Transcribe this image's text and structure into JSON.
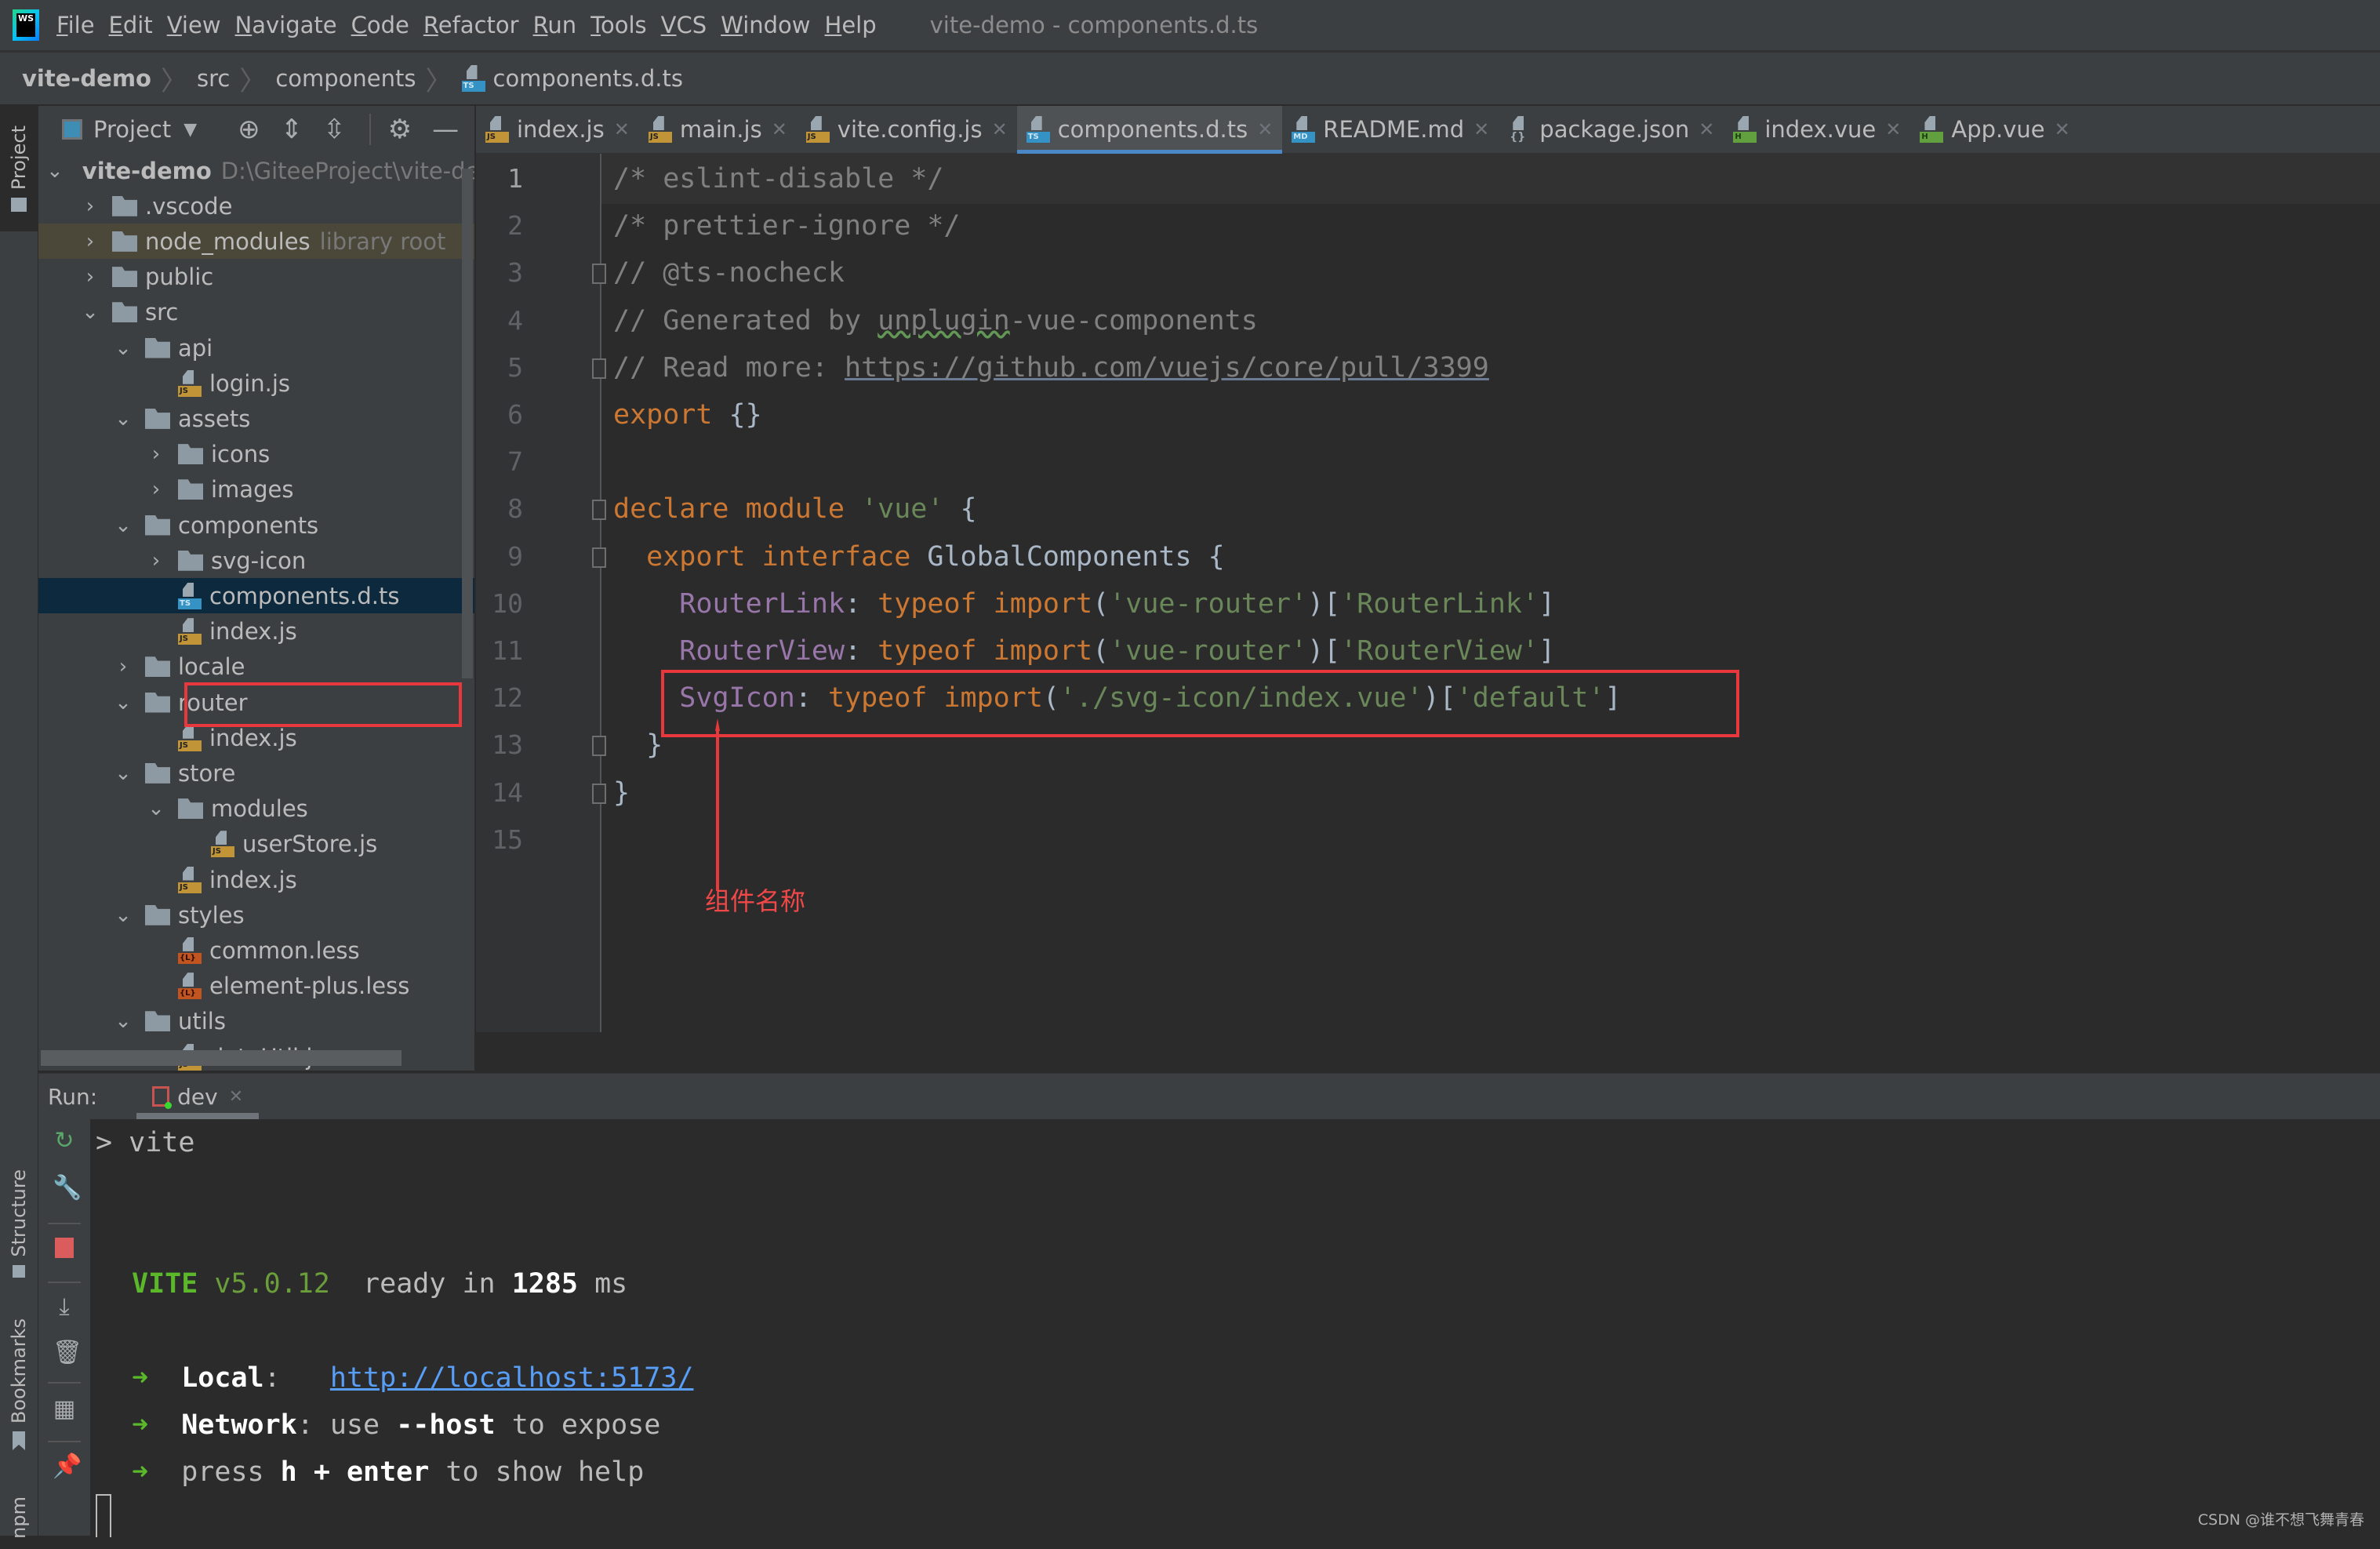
{
  "app": {
    "logo_text": "WS",
    "window_title": "vite-demo - components.d.ts"
  },
  "menu": [
    "File",
    "Edit",
    "View",
    "Navigate",
    "Code",
    "Refactor",
    "Run",
    "Tools",
    "VCS",
    "Window",
    "Help"
  ],
  "breadcrumb": [
    "vite-demo",
    "src",
    "components",
    "components.d.ts"
  ],
  "left_stripe": {
    "project": "Project",
    "structure": "Structure",
    "bookmarks": "Bookmarks",
    "npm": "npm"
  },
  "project_panel": {
    "view_label": "Project",
    "toolbar_icons": [
      "locate-icon",
      "expand-all-icon",
      "collapse-all-icon",
      "gear-icon",
      "hide-icon"
    ],
    "tree": [
      {
        "label": "vite-demo",
        "hint": "D:\\GiteeProject\\vite-demo",
        "type": "folder",
        "depth": 0,
        "expanded": true,
        "bold": true
      },
      {
        "label": ".vscode",
        "type": "folder",
        "depth": 1,
        "expanded": false
      },
      {
        "label": "node_modules",
        "hint": "library root",
        "type": "folder",
        "depth": 1,
        "expanded": false
      },
      {
        "label": "public",
        "type": "folder",
        "depth": 1,
        "expanded": false
      },
      {
        "label": "src",
        "type": "folder",
        "depth": 1,
        "expanded": true
      },
      {
        "label": "api",
        "type": "folder",
        "depth": 2,
        "expanded": true
      },
      {
        "label": "login.js",
        "type": "js",
        "depth": 3
      },
      {
        "label": "assets",
        "type": "folder",
        "depth": 2,
        "expanded": true
      },
      {
        "label": "icons",
        "type": "folder",
        "depth": 3,
        "expanded": false
      },
      {
        "label": "images",
        "type": "folder",
        "depth": 3,
        "expanded": false
      },
      {
        "label": "components",
        "type": "folder",
        "depth": 2,
        "expanded": true
      },
      {
        "label": "svg-icon",
        "type": "folder",
        "depth": 3,
        "expanded": false
      },
      {
        "label": "components.d.ts",
        "type": "ts",
        "depth": 3,
        "selected": true
      },
      {
        "label": "index.js",
        "type": "js",
        "depth": 3
      },
      {
        "label": "locale",
        "type": "folder",
        "depth": 2,
        "expanded": false
      },
      {
        "label": "router",
        "type": "folder",
        "depth": 2,
        "expanded": true
      },
      {
        "label": "index.js",
        "type": "js",
        "depth": 3
      },
      {
        "label": "store",
        "type": "folder",
        "depth": 2,
        "expanded": true
      },
      {
        "label": "modules",
        "type": "folder",
        "depth": 3,
        "expanded": true
      },
      {
        "label": "userStore.js",
        "type": "js",
        "depth": 4
      },
      {
        "label": "index.js",
        "type": "js",
        "depth": 3
      },
      {
        "label": "styles",
        "type": "folder",
        "depth": 2,
        "expanded": true
      },
      {
        "label": "common.less",
        "type": "less",
        "depth": 3
      },
      {
        "label": "element-plus.less",
        "type": "less",
        "depth": 3
      },
      {
        "label": "utils",
        "type": "folder",
        "depth": 2,
        "expanded": true
      },
      {
        "label": "dateUtil.js",
        "type": "js",
        "depth": 3
      }
    ]
  },
  "editor_tabs": [
    {
      "label": "index.js",
      "type": "js"
    },
    {
      "label": "main.js",
      "type": "js"
    },
    {
      "label": "vite.config.js",
      "type": "js"
    },
    {
      "label": "components.d.ts",
      "type": "ts",
      "active": true
    },
    {
      "label": "README.md",
      "type": "md"
    },
    {
      "label": "package.json",
      "type": "json"
    },
    {
      "label": "index.vue",
      "type": "vue"
    },
    {
      "label": "App.vue",
      "type": "vue"
    }
  ],
  "editor": {
    "current_line": 1,
    "lines": [
      [
        [
          "com",
          "/* eslint-disable */"
        ]
      ],
      [
        [
          "com",
          "/* prettier-ignore */"
        ]
      ],
      [
        [
          "com",
          "// @ts-nocheck"
        ]
      ],
      [
        [
          "com",
          "// Generated by "
        ],
        [
          "com typo",
          "unplugin"
        ],
        [
          "com",
          "-vue-components"
        ]
      ],
      [
        [
          "com",
          "// Read more: "
        ],
        [
          "com link",
          "https://github.com/vuejs/core/pull/3399"
        ]
      ],
      [
        [
          "kw",
          "export"
        ],
        [
          "plain",
          " {}"
        ]
      ],
      [],
      [
        [
          "kw",
          "declare module "
        ],
        [
          "str",
          "'vue'"
        ],
        [
          "plain",
          " {"
        ]
      ],
      [
        [
          "plain",
          "  "
        ],
        [
          "kw",
          "export interface "
        ],
        [
          "type",
          "GlobalComponents"
        ],
        [
          "plain",
          " {"
        ]
      ],
      [
        [
          "plain",
          "    "
        ],
        [
          "prop",
          "RouterLink"
        ],
        [
          "plain",
          ": "
        ],
        [
          "kw",
          "typeof import"
        ],
        [
          "plain",
          "("
        ],
        [
          "str",
          "'vue-router'"
        ],
        [
          "plain",
          ")["
        ],
        [
          "str",
          "'RouterLink'"
        ],
        [
          "plain",
          "]"
        ]
      ],
      [
        [
          "plain",
          "    "
        ],
        [
          "prop",
          "RouterView"
        ],
        [
          "plain",
          ": "
        ],
        [
          "kw",
          "typeof import"
        ],
        [
          "plain",
          "("
        ],
        [
          "str",
          "'vue-router'"
        ],
        [
          "plain",
          ")["
        ],
        [
          "str",
          "'RouterView'"
        ],
        [
          "plain",
          "]"
        ]
      ],
      [
        [
          "plain",
          "    "
        ],
        [
          "prop",
          "SvgIcon"
        ],
        [
          "plain",
          ": "
        ],
        [
          "kw",
          "typeof import"
        ],
        [
          "plain",
          "("
        ],
        [
          "str",
          "'./svg-icon/index.vue'"
        ],
        [
          "plain",
          ")["
        ],
        [
          "str",
          "'default'"
        ],
        [
          "plain",
          "]"
        ]
      ],
      [
        [
          "plain",
          "  }"
        ]
      ],
      [
        [
          "plain",
          "}"
        ]
      ],
      []
    ],
    "fold_markers": [
      3,
      5,
      8,
      9,
      13,
      14
    ],
    "annotation": {
      "label": "组件名称",
      "highlighted_line": 12,
      "color": "#e8383d"
    }
  },
  "run_panel": {
    "label": "Run:",
    "tab_label": "dev",
    "console": {
      "command": "> vite",
      "vite_name": "VITE",
      "vite_version": "v5.0.12",
      "ready_text": "ready in",
      "ready_ms": "1285",
      "ms_unit": "ms",
      "arrow": "➜",
      "local_label": "Local",
      "local_url": "http://localhost:5173/",
      "network_label": "Network",
      "network_use": "use",
      "network_flag": "--host",
      "network_rest": "to expose",
      "help_press": "press",
      "help_keys": "h + enter",
      "help_rest": "to show help"
    }
  },
  "watermark": "CSDN @谁不想飞舞青春"
}
